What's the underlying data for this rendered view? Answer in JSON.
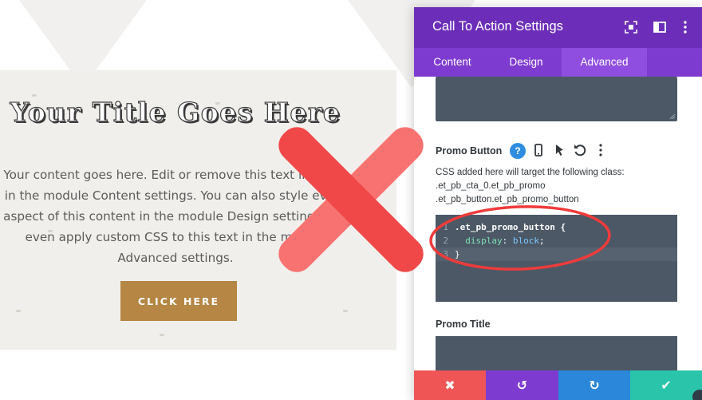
{
  "preview": {
    "title": "Your Title Goes Here",
    "body": "Your content goes here. Edit or remove this text inline or in the module Content settings. You can also style every aspect of this content in the module Design settings and even apply custom CSS to this text in the module Advanced settings.",
    "button_label": "CLICK HERE"
  },
  "panel": {
    "title": "Call To Action Settings",
    "header_icons": [
      "focus-icon",
      "columns-icon",
      "more-vertical-icon"
    ],
    "tabs": [
      {
        "label": "Content",
        "active": false
      },
      {
        "label": "Design",
        "active": false
      },
      {
        "label": "Advanced",
        "active": true
      }
    ],
    "section_label": "Promo Button",
    "section_tools": [
      "help-icon",
      "mobile-icon",
      "pointer-icon",
      "undo-icon",
      "more-vertical-icon"
    ],
    "note_line1": "CSS added here will target the following class:",
    "note_line2": ".et_pb_cta_0.et_pb_promo",
    "note_line3": ".et_pb_button.et_pb_promo_button",
    "code": [
      {
        "n": "1",
        "selector": ".et_pb_promo_button {"
      },
      {
        "n": "2",
        "prop": "display",
        "value": "block"
      },
      {
        "n": "3",
        "selector": "}"
      }
    ],
    "next_label": "Promo Title"
  },
  "footer": {
    "cancel": "✖",
    "undo": "↺",
    "redo": "↻",
    "save": "✔"
  },
  "colors": {
    "header": "#6c2eb9",
    "tabs": "#7e3bd0",
    "button": "#b58644",
    "cancel": "#ef5555",
    "undo": "#7e3bd0",
    "redo": "#2b87da",
    "save": "#29c4a9",
    "x_mark": "#f04848"
  }
}
